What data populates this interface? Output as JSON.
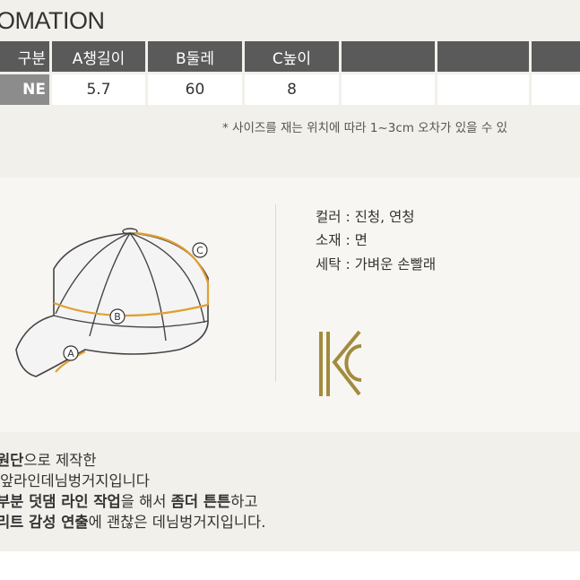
{
  "title": "OMATION",
  "table": {
    "headers": [
      "구분",
      "A챙길이",
      "B둘레",
      "C높이",
      "",
      "",
      ""
    ],
    "row": [
      "NE",
      "5.7",
      "60",
      "8",
      "",
      "",
      ""
    ]
  },
  "note": "* 사이즈를 재는 위치에 따라 1~3cm 오차가 있을 수 있",
  "diagram": {
    "labels": [
      "A",
      "B",
      "C"
    ],
    "accent": "#e0a030"
  },
  "specs": [
    "컬러 : 진청, 연청",
    "소재 : 면",
    "세탁 : 가벼운 손빨래"
  ],
  "kc_logo": {
    "text": "KC",
    "color": "#a38b3e"
  },
  "description": [
    {
      "bold": "원단",
      "rest": "으로 제작한"
    },
    {
      "bold": "",
      "rest": "앞라인데님벙거지입니다"
    },
    {
      "bold": "부분 덧댐 라인 작업",
      "rest": "을 해서 ",
      "bold2": "좀더 튼튼",
      "rest2": "하고"
    },
    {
      "bold": "리트 감성 연출",
      "rest": "에 괜찮은 데님벙거지입니다."
    }
  ]
}
